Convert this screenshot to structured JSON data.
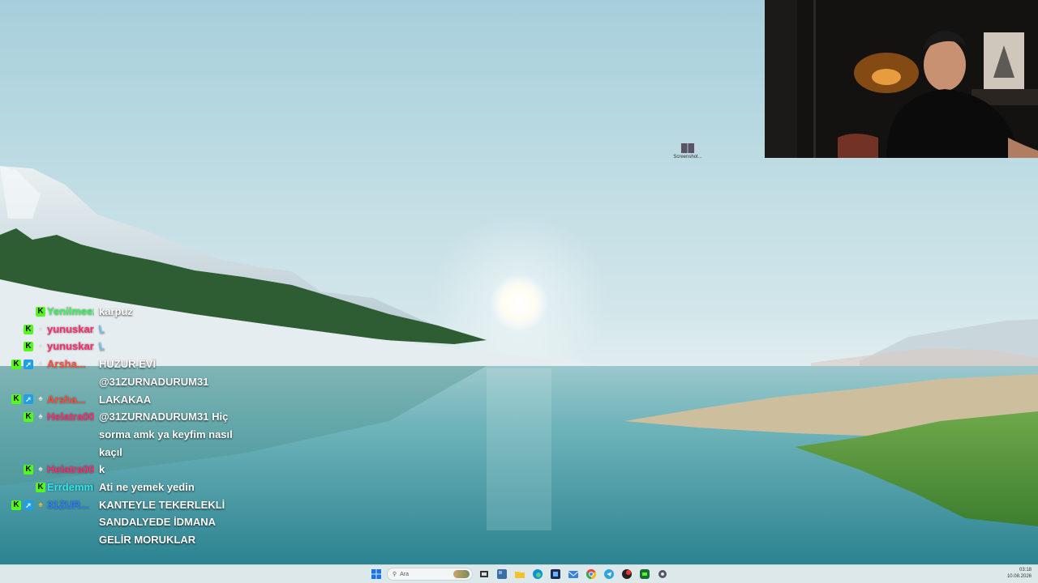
{
  "desktop": {
    "icon_label": "Screenshot..."
  },
  "chat": {
    "messages": [
      {
        "user": "Yenilmeez",
        "user_color": "#3df35a",
        "text": "karpuz",
        "badges": [
          "kick"
        ]
      },
      {
        "user": "yunuskar...",
        "user_color": "#ff2d6f",
        "text": "\\.",
        "badges": [
          "kick",
          "sub"
        ]
      },
      {
        "user": "yunuskar...",
        "user_color": "#ff2d6f",
        "text": "\\.",
        "badges": [
          "kick",
          "sub"
        ]
      },
      {
        "user": "Arsha...",
        "user_color": "#ff4d3b",
        "text": "HUZUR EVİ @31ZURNADURUM31",
        "badges": [
          "kick",
          "blue",
          "sub"
        ]
      },
      {
        "user": "Arsha...",
        "user_color": "#ff4d3b",
        "text": "LAKAKAA",
        "badges": [
          "kick",
          "blue",
          "sub"
        ]
      },
      {
        "user": "Helatra00",
        "user_color": "#ff2d6f",
        "text": "@31ZURNADURUM31 Hiç sorma amk ya keyfim nasıl kaçıl",
        "badges": [
          "kick",
          "sub"
        ]
      },
      {
        "user": "Helatra00",
        "user_color": "#ff2d6f",
        "text": "k",
        "badges": [
          "kick",
          "sub"
        ]
      },
      {
        "user": "ErrdemmBE...",
        "user_color": "#2fe6ec",
        "text": "Ati ne yemek yedin",
        "badges": [
          "kick"
        ]
      },
      {
        "user": "31ZUR...",
        "user_color": "#2e7dff",
        "text": "KANTEYLE TEKERLEKLİ SANDALYEDE İDMANA GELİR MORUKLAR",
        "badges": [
          "kick",
          "blue",
          "gold"
        ]
      }
    ]
  },
  "taskbar": {
    "search_placeholder": "Ara",
    "icons": [
      "windows-start-icon",
      "search",
      "task-view-icon",
      "widgets-icon",
      "file-explorer-icon",
      "edge-icon",
      "store-icon",
      "mail-icon",
      "chrome-icon",
      "telegram-icon",
      "app-red-icon",
      "app-green-icon",
      "settings-icon"
    ],
    "time": "03:18",
    "date": "10.08.2026"
  },
  "colors": {
    "kick_green": "#53fc18",
    "taskbar_bg": "#dde8ea"
  }
}
